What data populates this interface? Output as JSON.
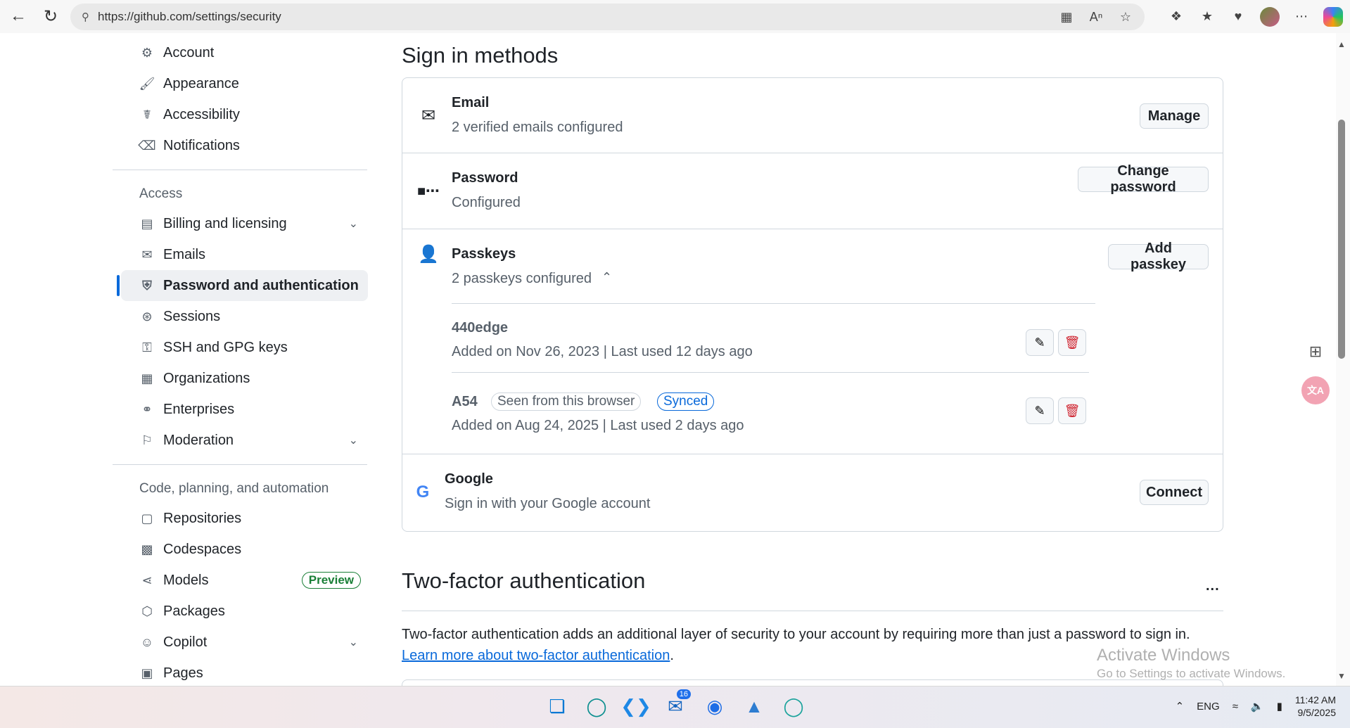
{
  "browser": {
    "url": "https://github.com/settings/security"
  },
  "sidebar": {
    "top_items": [
      {
        "label": "Account",
        "icon": "gear-icon"
      },
      {
        "label": "Appearance",
        "icon": "paintbrush-icon"
      },
      {
        "label": "Accessibility",
        "icon": "accessibility-icon"
      },
      {
        "label": "Notifications",
        "icon": "bell-icon"
      }
    ],
    "access_heading": "Access",
    "access_items": [
      {
        "label": "Billing and licensing",
        "icon": "credit-card-icon"
      },
      {
        "label": "Emails",
        "icon": "mail-icon"
      },
      {
        "label": "Password and authentication",
        "icon": "shield-lock-icon"
      },
      {
        "label": "Sessions",
        "icon": "broadcast-icon"
      },
      {
        "label": "SSH and GPG keys",
        "icon": "key-icon"
      },
      {
        "label": "Organizations",
        "icon": "organization-icon"
      },
      {
        "label": "Enterprises",
        "icon": "globe-icon"
      },
      {
        "label": "Moderation",
        "icon": "report-icon"
      }
    ],
    "code_heading": "Code, planning, and automation",
    "code_items": [
      {
        "label": "Repositories",
        "icon": "repo-icon"
      },
      {
        "label": "Codespaces",
        "icon": "codespaces-icon"
      },
      {
        "label": "Models",
        "icon": "models-icon",
        "badge": "Preview"
      },
      {
        "label": "Packages",
        "icon": "package-icon"
      },
      {
        "label": "Copilot",
        "icon": "copilot-icon"
      },
      {
        "label": "Pages",
        "icon": "browser-icon"
      }
    ]
  },
  "main": {
    "sign_in_title": "Sign in methods",
    "email": {
      "title": "Email",
      "subtitle": "2 verified emails configured",
      "button": "Manage"
    },
    "password": {
      "title": "Password",
      "subtitle": "Configured",
      "button": "Change password"
    },
    "passkeys": {
      "title": "Passkeys",
      "subtitle": "2 passkeys configured",
      "button": "Add passkey",
      "items": [
        {
          "name": "440edge",
          "meta": "Added on Nov 26, 2023 | Last used 12 days ago"
        },
        {
          "name": "A54",
          "badge1": "Seen from this browser",
          "badge2": "Synced",
          "meta": "Added on Aug 24, 2025 | Last used 2 days ago"
        }
      ]
    },
    "google": {
      "title": "Google",
      "subtitle": "Sign in with your Google account",
      "button": "Connect"
    },
    "tfa_title": "Two-factor authentication",
    "tfa_more": "...",
    "tfa_desc": "Two-factor authentication adds an additional layer of security to your account by requiring more than just a password to sign in.",
    "tfa_link": "Learn more about two-factor authentication",
    "tfa_link_suffix": "."
  },
  "watermark": {
    "line1": "Activate Windows",
    "line2": "Go to Settings to activate Windows."
  },
  "taskbar": {
    "notification_count": "16",
    "language": "ENG",
    "time": "11:42 AM",
    "date": "9/5/2025"
  },
  "colors": {
    "accent": "#0969da",
    "danger": "#cf222e",
    "success": "#1a7f37"
  }
}
